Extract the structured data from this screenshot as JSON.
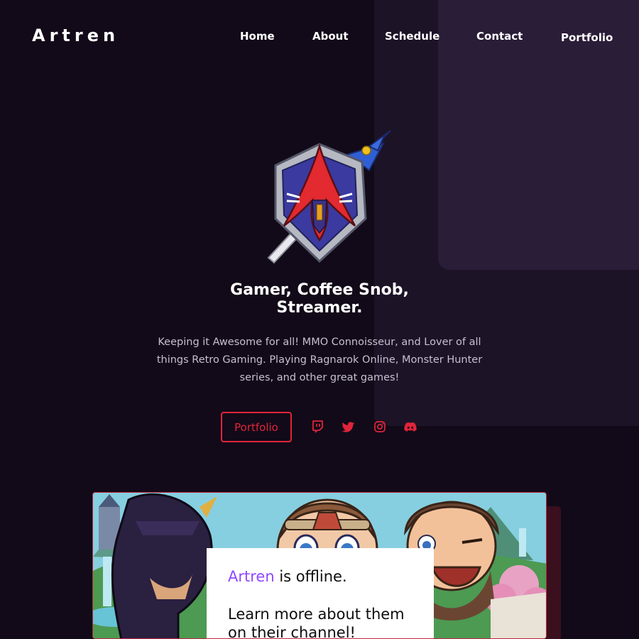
{
  "site": {
    "logo": "Artren"
  },
  "nav": {
    "items": [
      {
        "label": "Home"
      },
      {
        "label": "About"
      },
      {
        "label": "Schedule"
      },
      {
        "label": "Contact"
      },
      {
        "label": "Portfolio"
      }
    ]
  },
  "hero": {
    "headline_line1": "Gamer, Coffee Snob,",
    "headline_line2": "Streamer.",
    "tagline": "Keeping it Awesome for all! MMO Connoisseur, and Lover of all things Retro Gaming. Playing Ragnarok Online, Monster Hunter series, and other great games!",
    "cta_label": "Portfolio",
    "accent_color": "#e2243a"
  },
  "social": {
    "icons": [
      "twitch-icon",
      "twitter-icon",
      "instagram-icon",
      "discord-icon"
    ]
  },
  "stream": {
    "channel_name": "Artren",
    "status_text": " is offline.",
    "learn_more": "Learn more about them on their channel!",
    "channel_name_color": "#9147ff"
  }
}
